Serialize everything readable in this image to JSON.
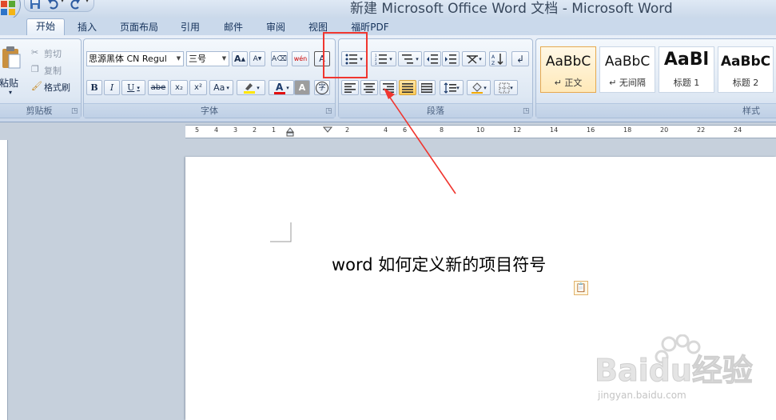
{
  "title_bar": {
    "title": "新建 Microsoft Office Word 文档 - Microsoft Word"
  },
  "tabs": [
    {
      "label": "开始",
      "active": true
    },
    {
      "label": "插入"
    },
    {
      "label": "页面布局"
    },
    {
      "label": "引用"
    },
    {
      "label": "邮件"
    },
    {
      "label": "审阅"
    },
    {
      "label": "视图"
    },
    {
      "label": "福昕PDF"
    }
  ],
  "clipboard": {
    "paste": "粘贴",
    "cut": "剪切",
    "copy": "复制",
    "format_painter": "格式刷",
    "group_label": "剪贴板"
  },
  "font": {
    "name": "思源黑体 CN Regul",
    "size": "三号",
    "bold": "B",
    "italic": "I",
    "underline": "U",
    "strike": "abe",
    "subscript": "x₂",
    "superscript": "x²",
    "change_case": "Aa",
    "grow": "A",
    "shrink": "A",
    "phonetic": "wén",
    "group_label": "字体"
  },
  "paragraph": {
    "group_label": "段落"
  },
  "styles": {
    "group_label": "样式",
    "items": [
      {
        "sample": "AaBbC",
        "name": "↵ 正文",
        "selected": true
      },
      {
        "sample": "AaBbC",
        "name": "↵ 无间隔"
      },
      {
        "sample": "AaBl",
        "name": "标题 1"
      },
      {
        "sample": "AaBbC",
        "name": "标题 2"
      }
    ]
  },
  "ruler": {
    "left_numbers": [
      "5",
      "4",
      "3",
      "2",
      "1"
    ],
    "right_numbers": [
      "2",
      "4",
      "6",
      "8",
      "10",
      "12",
      "14",
      "16",
      "18",
      "20",
      "22",
      "24"
    ]
  },
  "document": {
    "text": "word 如何定义新的项目符号"
  },
  "watermark": {
    "brand": "Baidu经验",
    "url": "jingyan.baidu.com"
  },
  "colors": {
    "highlight": "#f0362f",
    "ribbon_bg": "#dde7f3",
    "workspace": "#c6d0dc"
  }
}
